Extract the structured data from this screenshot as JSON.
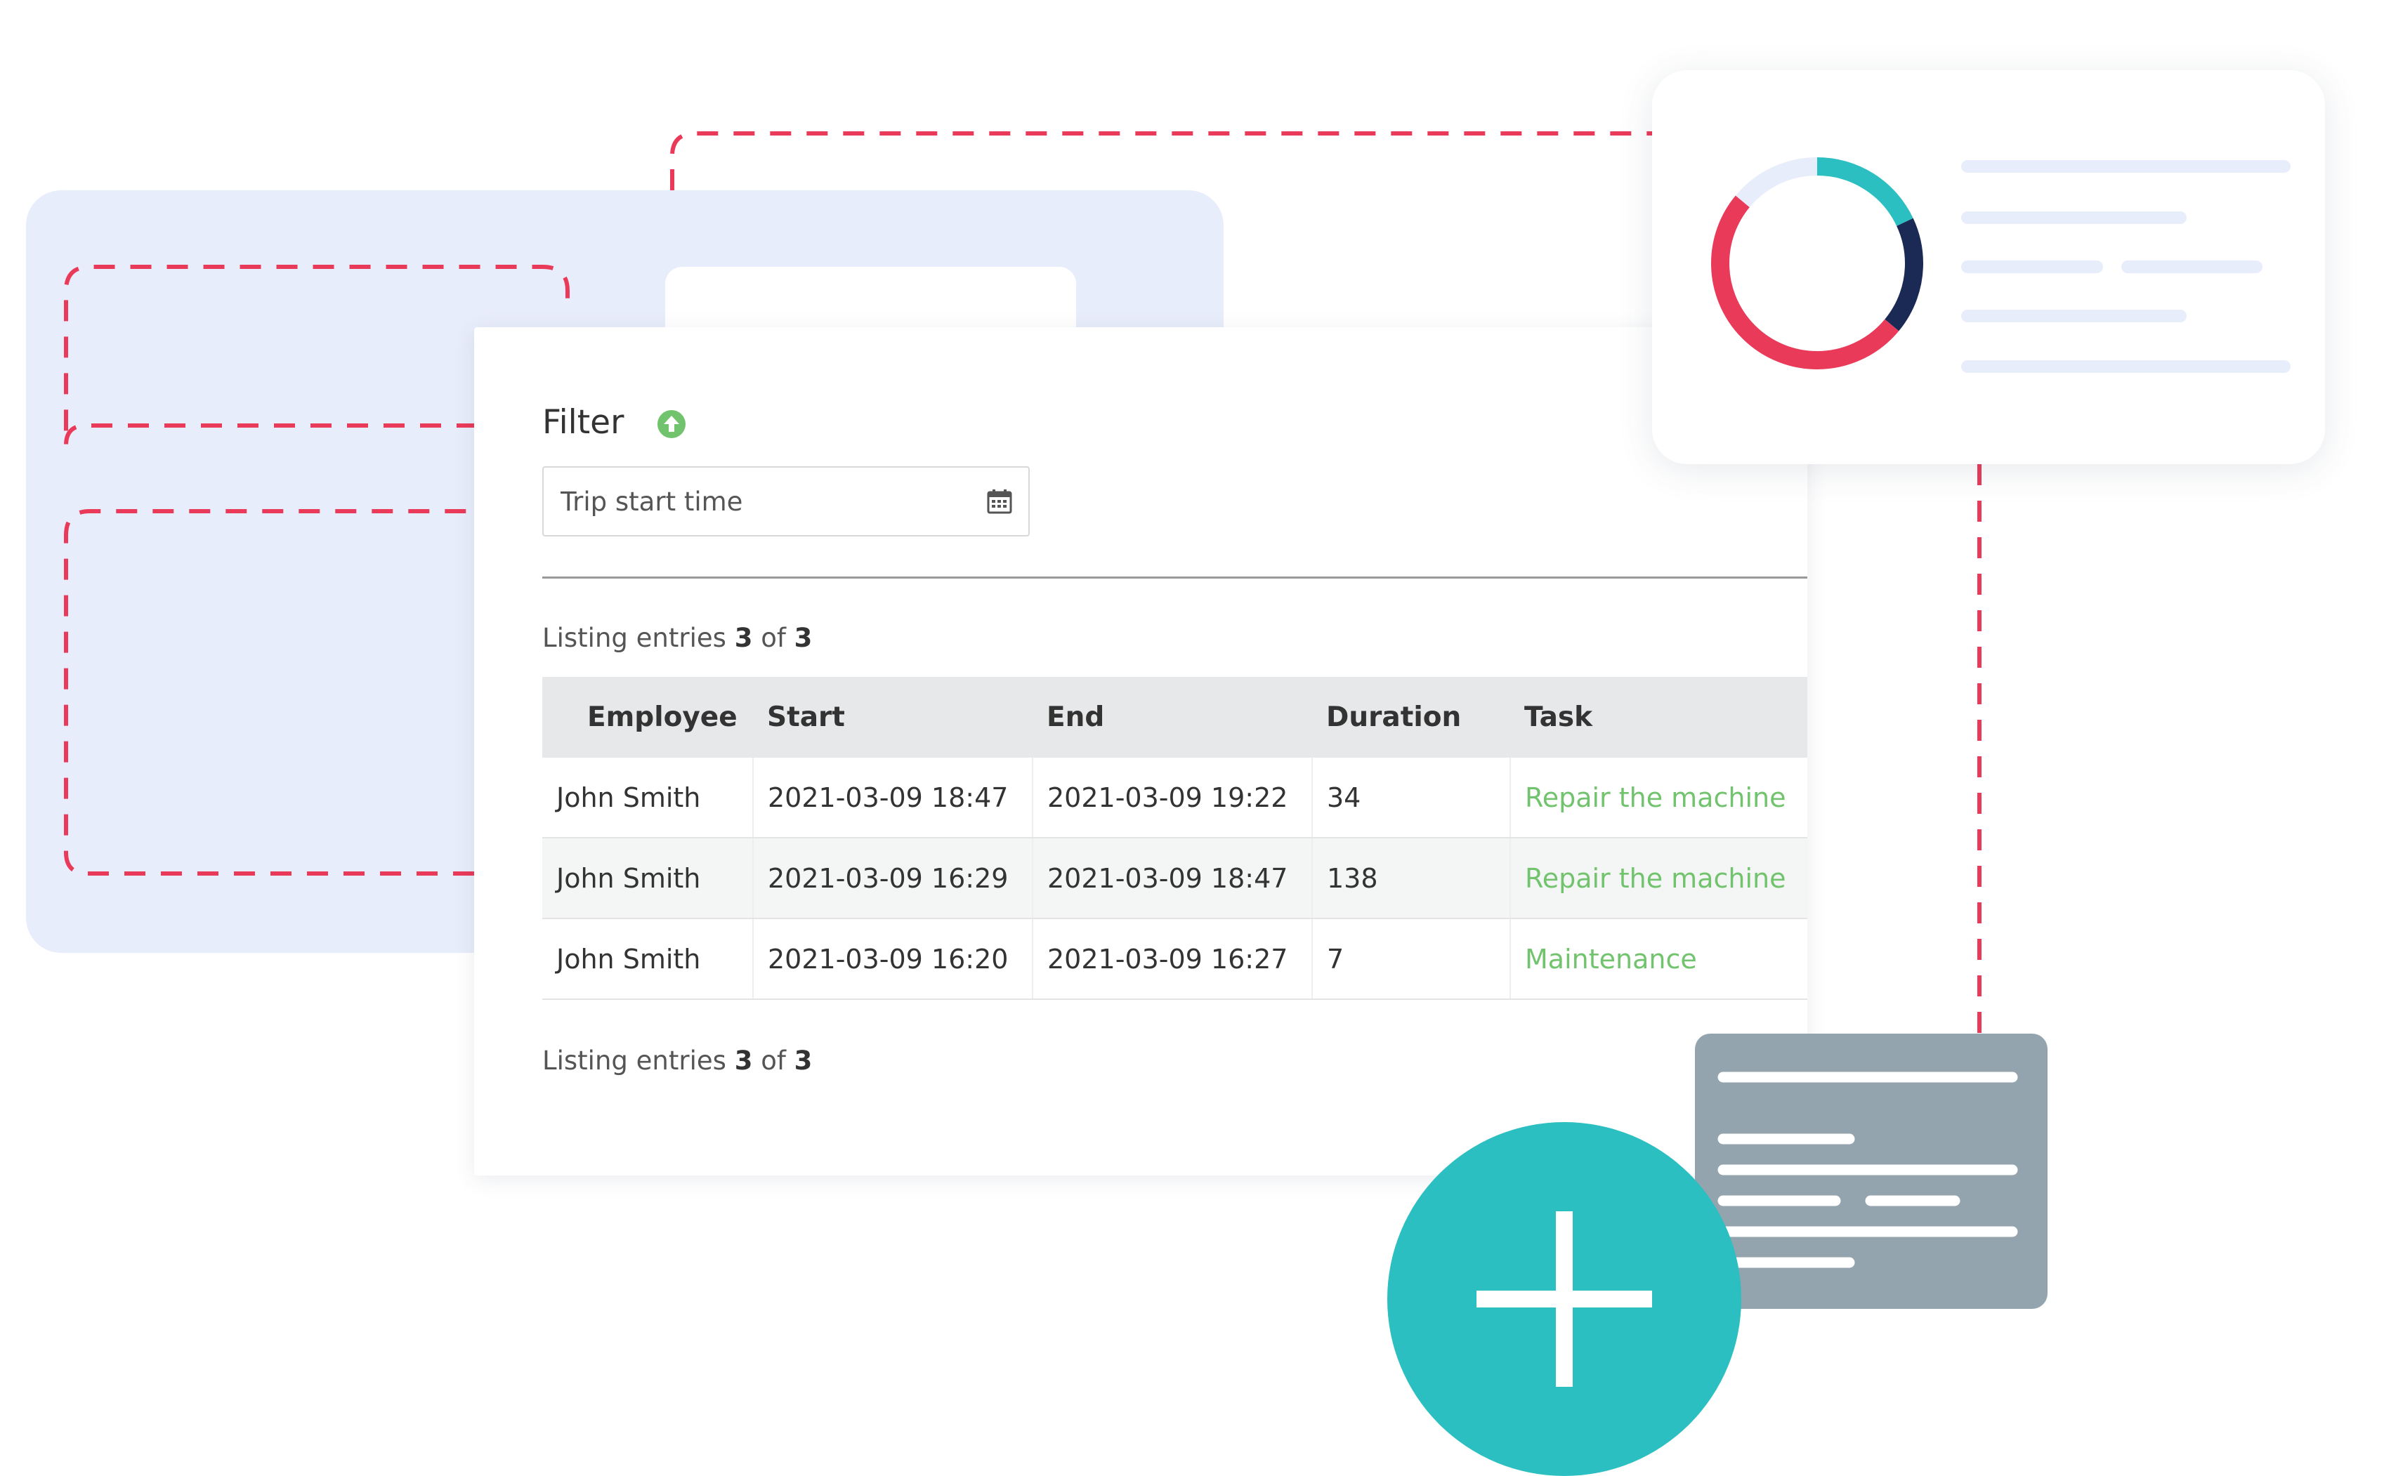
{
  "colors": {
    "accent_red": "#ea3a59",
    "teal": "#2bbfc1",
    "navy": "#1b2a55",
    "task_green": "#72c36d",
    "panel_lavender": "#e8edfb",
    "note_grey": "#93a4ae"
  },
  "filter": {
    "title": "Filter",
    "toggle_icon": "arrow-up-circle-icon",
    "date_placeholder": "Trip start time",
    "date_icon": "calendar-icon"
  },
  "listing": {
    "prefix": "Listing entries",
    "shown": "3",
    "of": "of",
    "total": "3"
  },
  "table": {
    "headers": [
      "Employee",
      "Start",
      "End",
      "Duration",
      "Task"
    ],
    "rows": [
      [
        "John Smith",
        "2021-03-09 18:47",
        "2021-03-09 19:22",
        "34",
        "Repair the machine"
      ],
      [
        "John Smith",
        "2021-03-09 16:29",
        "2021-03-09 18:47",
        "138",
        "Repair the machine"
      ],
      [
        "John Smith",
        "2021-03-09 16:20",
        "2021-03-09 16:27",
        "7",
        "Maintenance"
      ]
    ]
  },
  "donut": {
    "segments": [
      {
        "color": "#2bbfc1",
        "fraction": 0.18
      },
      {
        "color": "#1b2a55",
        "fraction": 0.18
      },
      {
        "color": "#ea3a59",
        "fraction": 0.5
      },
      {
        "color": "#e8edfb",
        "fraction": 0.14
      }
    ]
  },
  "add_button": {
    "icon": "plus-icon"
  }
}
